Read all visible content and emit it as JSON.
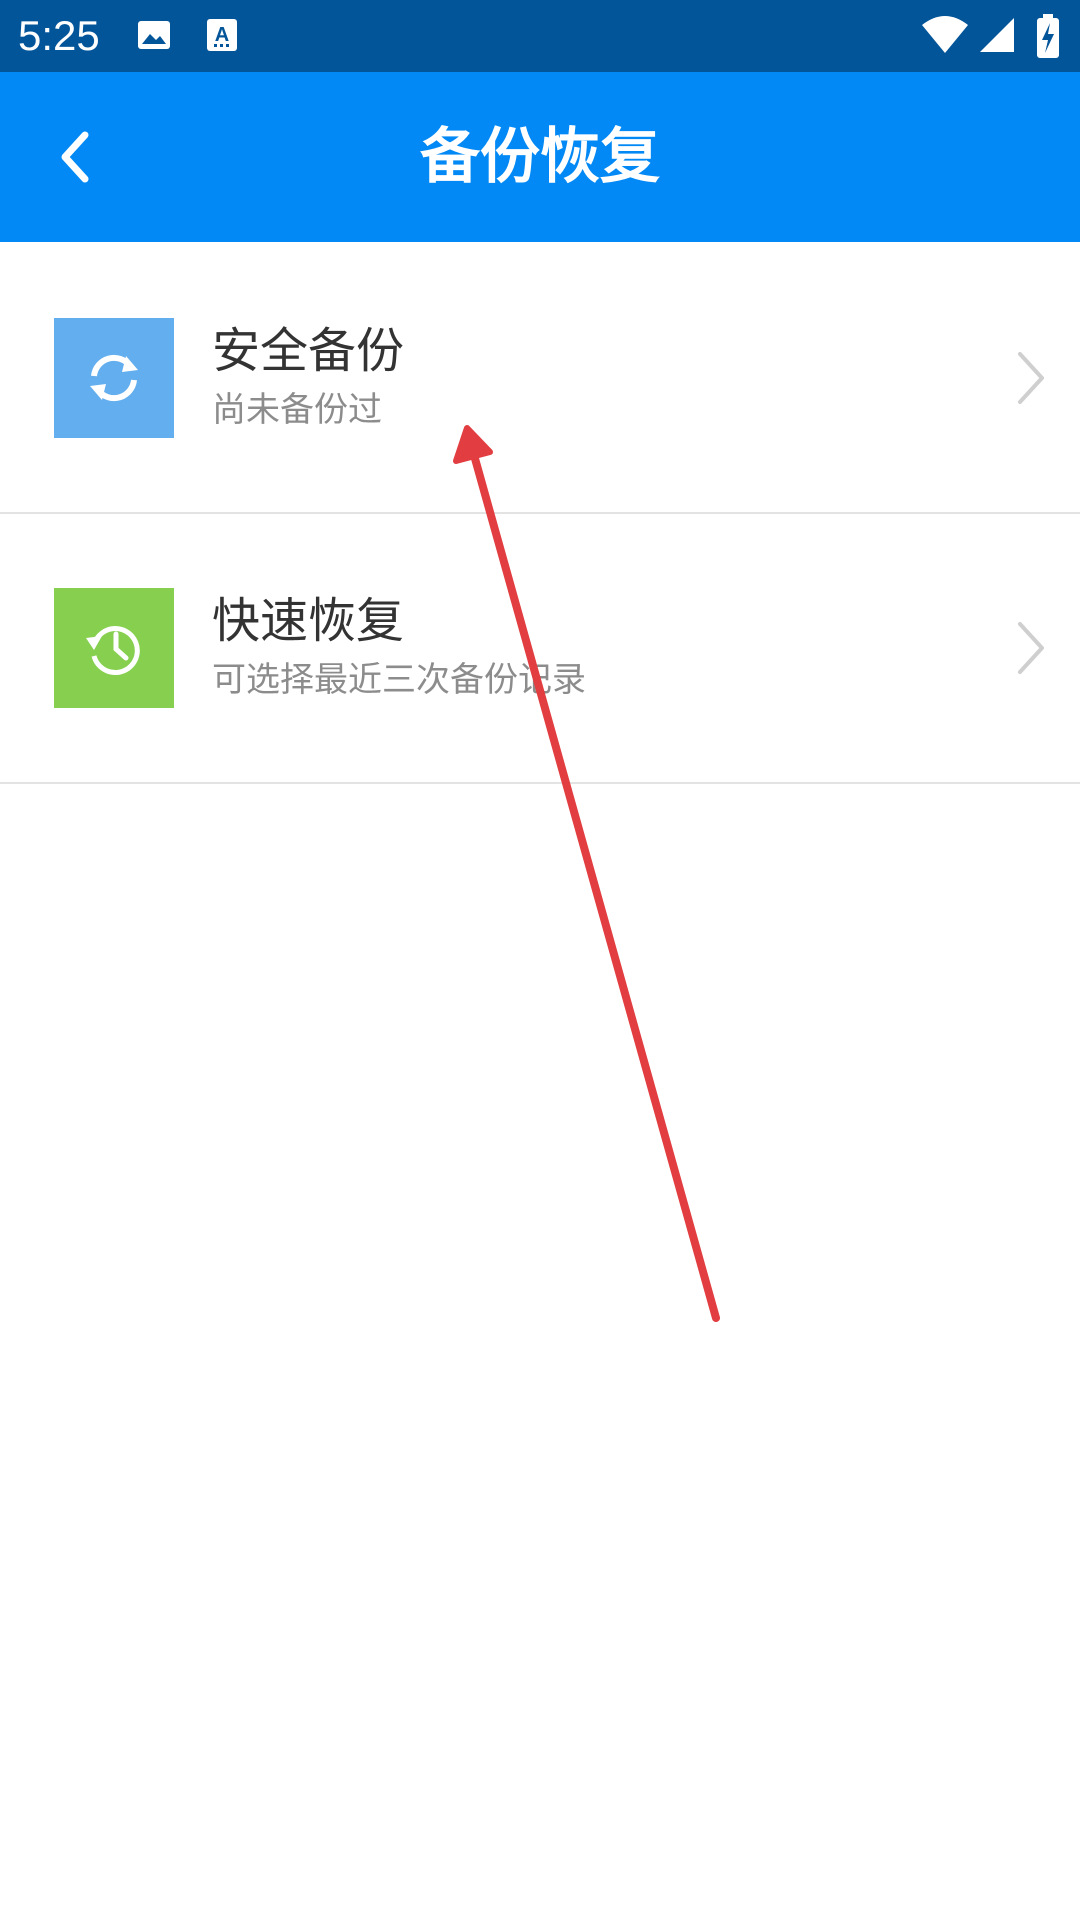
{
  "status_bar": {
    "time": "5:25",
    "left_icons": [
      "image-icon",
      "text-a-icon"
    ],
    "right_icons": [
      "wifi-icon",
      "cell-signal-icon",
      "battery-charging-icon"
    ],
    "background": "#03559a"
  },
  "app_bar": {
    "title": "备份恢复",
    "back_icon": "chevron-left-icon",
    "background": "#0289f5"
  },
  "list": {
    "items": [
      {
        "title": "安全备份",
        "subtitle": "尚未备份过",
        "icon": "sync-icon",
        "icon_color": "#63aeee"
      },
      {
        "title": "快速恢复",
        "subtitle": "可选择最近三次备份记录",
        "icon": "history-icon",
        "icon_color": "#87d04f"
      }
    ]
  },
  "annotation": {
    "arrow_color": "#e23d40"
  }
}
